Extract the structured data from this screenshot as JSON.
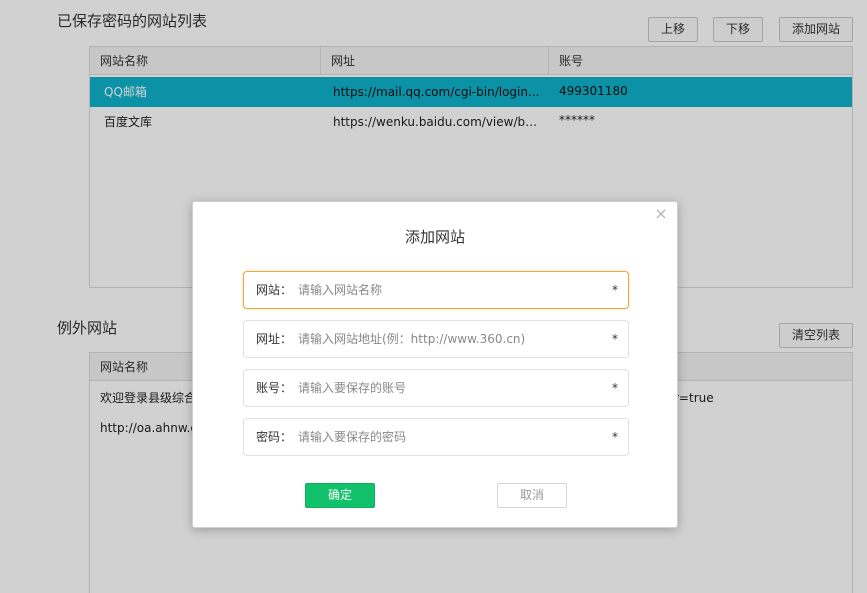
{
  "saved": {
    "title": "已保存密码的网站列表",
    "buttons": {
      "up": "上移",
      "down": "下移",
      "add": "添加网站"
    },
    "columns": [
      "网站名称",
      "网址",
      "账号"
    ],
    "rows": [
      {
        "name": "QQ邮箱",
        "url": "https://mail.qq.com/cgi-bin/login...",
        "account": "499301180"
      },
      {
        "name": "百度文库",
        "url": "https://wenku.baidu.com/view/bc...",
        "account": "******"
      }
    ]
  },
  "exceptions": {
    "title": "例外网站",
    "buttons": {
      "clear": "清空列表"
    },
    "columns": [
      "网站名称"
    ],
    "rows": [
      {
        "name": "欢迎登录县级综合",
        "tail": "r=true"
      },
      {
        "name": "http://oa.ahnw.g"
      }
    ]
  },
  "dialog": {
    "title": "添加网站",
    "close_glyph": "×",
    "fields": [
      {
        "label": "网站：",
        "placeholder": "请输入网站名称",
        "required": "*"
      },
      {
        "label": "网址：",
        "placeholder": "请输入网站地址(例：http://www.360.cn)",
        "required": "*"
      },
      {
        "label": "账号：",
        "placeholder": "请输入要保存的账号",
        "required": "*"
      },
      {
        "label": "密码：",
        "placeholder": "请输入要保存的密码",
        "required": "*"
      }
    ],
    "ok_label": "确定",
    "cancel_label": "取消"
  },
  "colors": {
    "selected_row": "#0fb2cb",
    "ok_button": "#12c26a",
    "focus_border": "#f0a83c"
  }
}
